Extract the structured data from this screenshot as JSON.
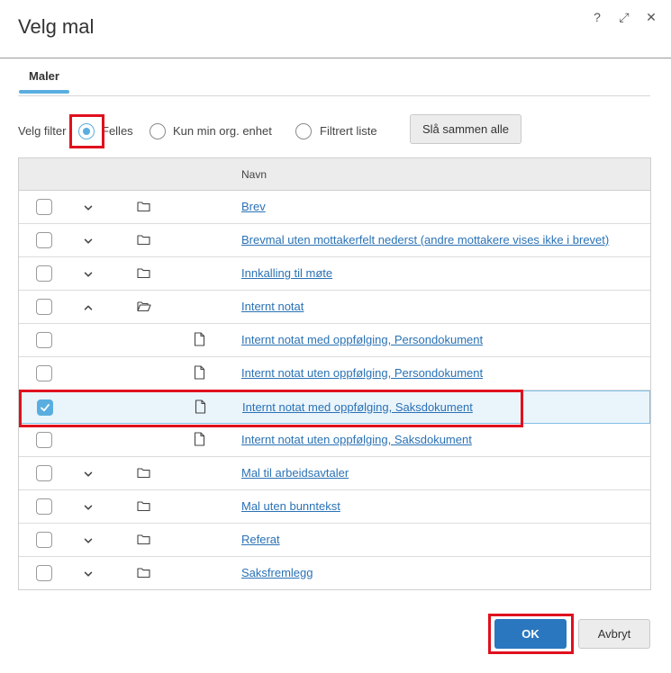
{
  "dialog": {
    "title": "Velg mal",
    "controls": [
      {
        "name": "help-icon",
        "glyph": "?"
      },
      {
        "name": "maximize-icon",
        "glyph": "⤢"
      },
      {
        "name": "close-icon",
        "glyph": "✕"
      }
    ]
  },
  "tabs": [
    {
      "label": "Maler",
      "active": true
    }
  ],
  "filter": {
    "label": "Velg filter",
    "options": [
      {
        "label": "Felles",
        "selected": true
      },
      {
        "label": "Kun min org. enhet",
        "selected": false
      },
      {
        "label": "Filtrert liste",
        "selected": false
      }
    ],
    "merge_button": "Slå sammen alle"
  },
  "table": {
    "header": "Navn",
    "rows": [
      {
        "label": "Brev",
        "type": "folder",
        "expanded": false,
        "checked": false
      },
      {
        "label": "Brevmal uten mottakerfelt nederst (andre mottakere vises ikke i brevet)",
        "type": "folder",
        "expanded": false,
        "checked": false
      },
      {
        "label": "Innkalling til møte",
        "type": "folder",
        "expanded": false,
        "checked": false
      },
      {
        "label": "Internt notat",
        "type": "folder",
        "expanded": true,
        "checked": false
      },
      {
        "label": "Internt notat med oppfølging, Persondokument",
        "type": "file",
        "checked": false
      },
      {
        "label": "Internt notat uten oppfølging, Persondokument",
        "type": "file",
        "checked": false
      },
      {
        "label": "Internt notat med oppfølging, Saksdokument",
        "type": "file",
        "checked": true
      },
      {
        "label": "Internt notat uten oppfølging, Saksdokument",
        "type": "file",
        "checked": false
      },
      {
        "label": "Mal til arbeidsavtaler",
        "type": "folder",
        "expanded": false,
        "checked": false
      },
      {
        "label": "Mal uten bunntekst",
        "type": "folder",
        "expanded": false,
        "checked": false
      },
      {
        "label": "Referat",
        "type": "folder",
        "expanded": false,
        "checked": false
      },
      {
        "label": "Saksfremlegg",
        "type": "folder",
        "expanded": false,
        "checked": false
      }
    ]
  },
  "footer": {
    "ok": "OK",
    "cancel": "Avbryt"
  },
  "colors": {
    "accent": "#5aaedf",
    "primary_button": "#2a77bf",
    "link": "#2a72b5",
    "highlight": "#e0101e"
  }
}
